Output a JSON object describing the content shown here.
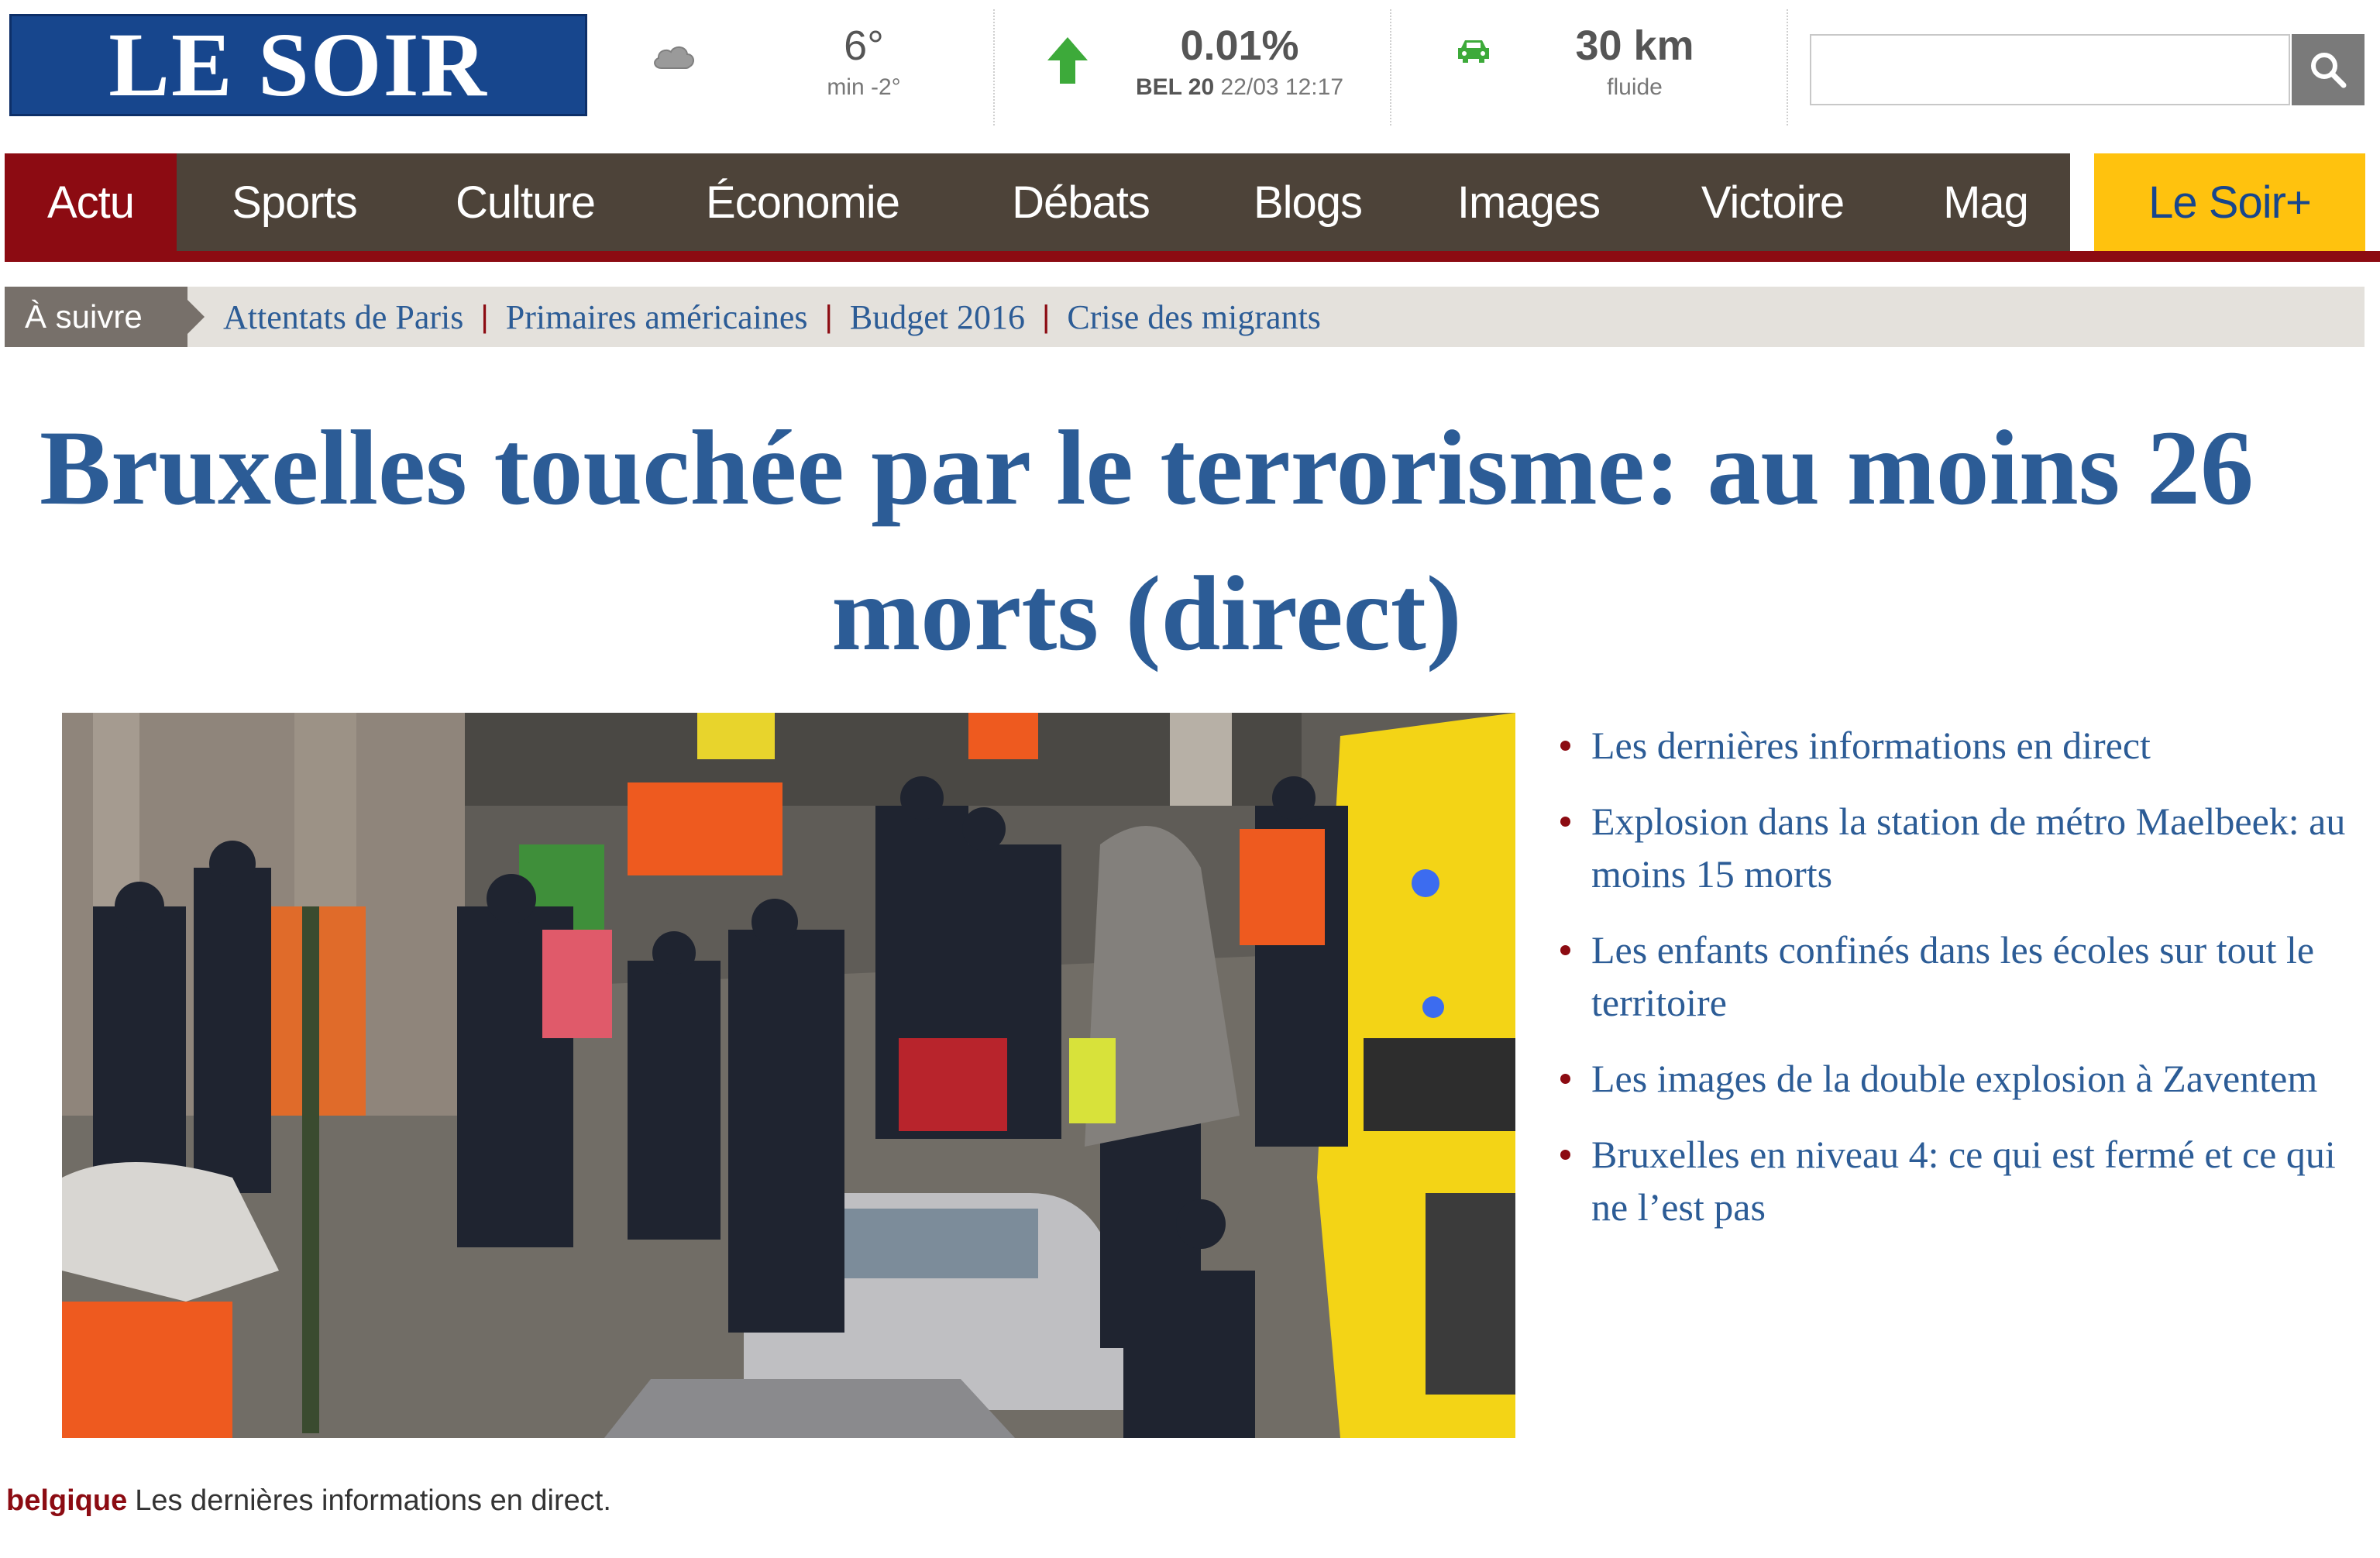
{
  "brand": {
    "logo_text": "LE SOIR"
  },
  "weather": {
    "icon": "cloud-icon",
    "temp": "6°",
    "min": "min -2°"
  },
  "bourse": {
    "icon": "arrow-up-icon",
    "change": "0.01%",
    "index": "BEL 20",
    "datetime": "22/03 12:17",
    "color": "#3daa3a"
  },
  "traffic": {
    "icon": "car-icon",
    "distance": "30 km",
    "status": "fluide",
    "color": "#3daa3a"
  },
  "search": {
    "placeholder": "",
    "button_icon": "search-icon"
  },
  "nav": {
    "items": [
      "Actu",
      "Sports",
      "Culture",
      "Économie",
      "Débats",
      "Blogs",
      "Images",
      "Victoire",
      "Mag"
    ],
    "active": "Actu",
    "plus": "Le Soir+"
  },
  "follow": {
    "label": "À suivre",
    "links": [
      "Attentats de Paris",
      "Primaires américaines",
      "Budget 2016",
      "Crise des migrants"
    ]
  },
  "article": {
    "headline": "Bruxelles touchée par le terrorisme: au moins 26 morts (direct)",
    "related": [
      "Les dernières informations en direct",
      "Explosion dans la station de métro Maelbeek: au moins 15 morts",
      "Les enfants confinés dans les écoles sur tout le territoire",
      "Les images de la double explosion à Zaventem",
      "Bruxelles en niveau 4: ce qui est fermé et ce qui ne l’est pas"
    ],
    "caption_tag": "belgique",
    "caption_text": "Les dernières informations en direct."
  },
  "colors": {
    "brand_blue": "#17468d",
    "nav_brown": "#4d4339",
    "accent_red": "#8c0b12",
    "plus_yellow": "#ffc20e",
    "link_blue": "#2c5c96"
  }
}
